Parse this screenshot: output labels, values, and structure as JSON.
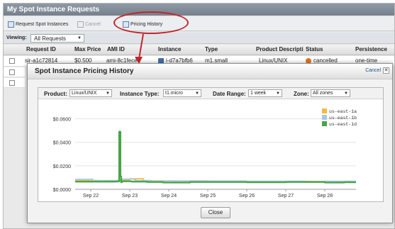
{
  "console": {
    "title": "My Spot Instance Requests",
    "toolbar": {
      "request_label": "Request Spot Instances",
      "cancel_label": "Cancel",
      "pricing_label": "Pricing History"
    },
    "viewing_label": "Viewing:",
    "viewing_value": "All Requests",
    "columns": [
      "Request ID",
      "Max Price",
      "AMI ID",
      "Instance",
      "Type",
      "Product Descripti",
      "Status",
      "Persistence"
    ],
    "row": {
      "request_id": "sir-a1c72814",
      "max_price": "$0.500",
      "ami_id": "ami-8c1fece5",
      "instance": "i-d7a7bfb6",
      "type": "m1.small",
      "product": "Linux/UNIX",
      "status": "cancelled",
      "persistence": "one-time"
    },
    "status_color": "#e0731f"
  },
  "modal": {
    "title": "Spot Instance Pricing History",
    "cancel_label": "Cancel",
    "close_icon": "close-icon",
    "close_button_label": "Close",
    "filters": {
      "product_label": "Product:",
      "product_value": "Linux/UNIX",
      "instance_type_label": "Instance Type:",
      "instance_type_value": "t1.micro",
      "date_range_label": "Date Range:",
      "date_range_value": "1 week",
      "zone_label": "Zone:",
      "zone_value": "All zones"
    }
  },
  "chart_data": {
    "type": "line",
    "title": "",
    "xlabel": "",
    "ylabel": "",
    "x_ticks": [
      "Sep 22",
      "Sep 23",
      "Sep 24",
      "Sep 25",
      "Sep 26",
      "Sep 27",
      "Sep 28"
    ],
    "y_ticks": [
      "$0.0000",
      "$0.0200",
      "$0.0400",
      "$0.0600"
    ],
    "ylim": [
      0,
      0.07
    ],
    "xlim": [
      21.6,
      28.8
    ],
    "grid": true,
    "legend_position": "top-right",
    "series": [
      {
        "name": "us-east-1a",
        "color": "#f5b942",
        "x": [
          21.6,
          22.15,
          22.2,
          22.7,
          22.75,
          23.0,
          23.3,
          23.35,
          24.0,
          24.1,
          25.0,
          25.5,
          26.0,
          27.0,
          28.0,
          28.8
        ],
        "y": [
          0.0075,
          0.0075,
          0.0068,
          0.0068,
          0.0078,
          0.009,
          0.009,
          0.0072,
          0.0072,
          0.0069,
          0.0068,
          0.0068,
          0.0067,
          0.0067,
          0.0066,
          0.0066
        ]
      },
      {
        "name": "us-east-1b",
        "color": "#a9c6e2",
        "x": [
          21.6,
          22.0,
          22.05,
          22.7,
          22.72,
          23.0,
          23.1,
          23.15,
          23.5,
          23.55,
          24.0,
          25.0,
          26.0,
          27.0,
          27.5,
          28.0,
          28.8
        ],
        "y": [
          0.0085,
          0.0085,
          0.0074,
          0.0074,
          0.0086,
          0.0088,
          0.0082,
          0.0074,
          0.0074,
          0.007,
          0.0071,
          0.007,
          0.0069,
          0.0068,
          0.0066,
          0.0068,
          0.0068
        ]
      },
      {
        "name": "us-east-1d",
        "color": "#49a549",
        "x": [
          21.6,
          22.5,
          22.65,
          22.72,
          22.73,
          22.75,
          22.76,
          22.78,
          22.8,
          23.0,
          23.05,
          23.4,
          23.45,
          23.8,
          23.85,
          24.5,
          24.55,
          25.5,
          26.0,
          26.5,
          27.0,
          28.0,
          28.5,
          28.8
        ],
        "y": [
          0.0065,
          0.0065,
          0.0067,
          0.0067,
          0.049,
          0.049,
          0.011,
          0.006,
          0.0068,
          0.0068,
          0.0065,
          0.0065,
          0.0062,
          0.0062,
          0.0058,
          0.0058,
          0.0062,
          0.0062,
          0.006,
          0.006,
          0.0062,
          0.0058,
          0.006,
          0.006
        ]
      }
    ]
  }
}
